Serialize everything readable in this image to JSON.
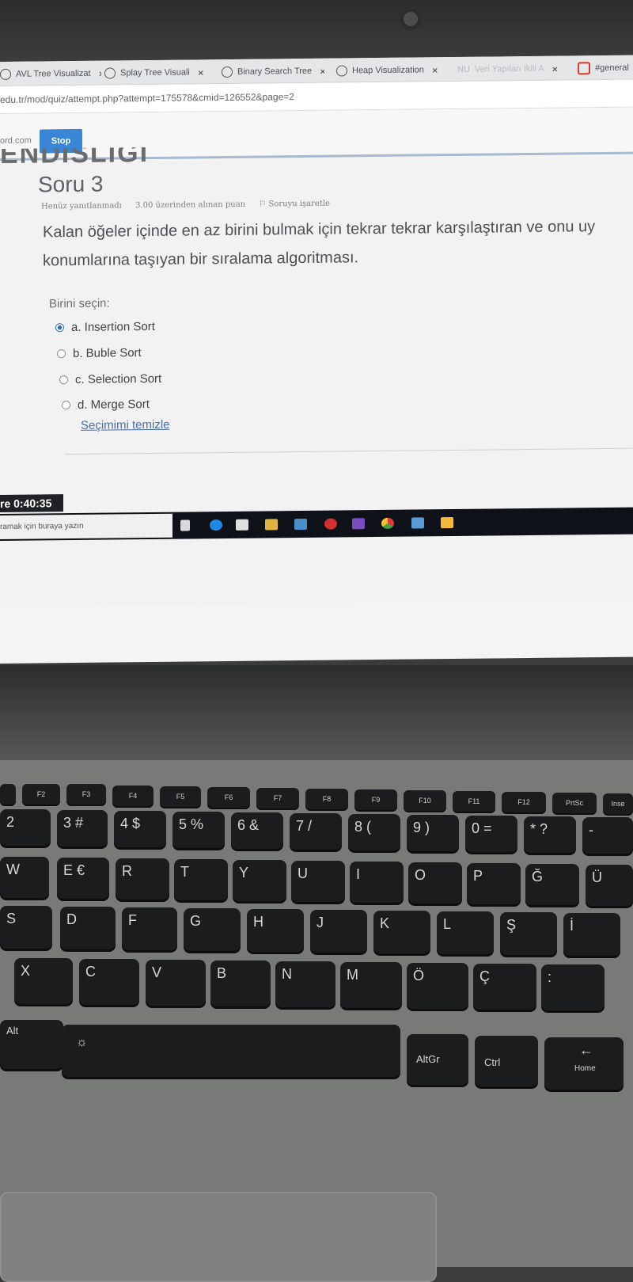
{
  "browser": {
    "tabs": [
      {
        "label": "AVL Tree Visualizat",
        "close": "×"
      },
      {
        "label": "Splay Tree Visuali",
        "close": "×"
      },
      {
        "label": "Binary Search Tree",
        "close": "×"
      },
      {
        "label": "Heap Visualization",
        "close": "×"
      },
      {
        "label": "Veri Yapıları İkili A",
        "close": "×",
        "prefix": "NU"
      },
      {
        "label": "#general",
        "close": ""
      }
    ],
    "url": "edu.tr/mod/quiz/attempt.php?attempt=175578&cmid=126552&page=2"
  },
  "bar": {
    "site": "ord.com",
    "stop_label": "Stop"
  },
  "banner": {
    "text": "ENDISLIGI"
  },
  "question": {
    "title": "Soru 3",
    "status": "Henüz yanıtlanmadı",
    "points": "3.00 üzerinden alınan puan",
    "flag": "Soruyu işaretle",
    "text": "Kalan öğeler içinde en az birini bulmak için tekrar tekrar karşılaştıran ve onu uy konumlarına taşıyan bir sıralama algoritması.",
    "choose_label": "Birini seçin:",
    "options": [
      {
        "label": "a. Insertion Sort",
        "selected": true
      },
      {
        "label": "b. Buble Sort",
        "selected": false
      },
      {
        "label": "c. Selection Sort",
        "selected": false
      },
      {
        "label": "d. Merge Sort",
        "selected": false
      }
    ],
    "clear_label": "Seçimimi temizle"
  },
  "timer": {
    "text": "re 0:40:35"
  },
  "taskbar": {
    "search_placeholder": "ramak için buraya yazın"
  },
  "keyboard": {
    "row_numbers": [
      "2",
      "3 #",
      "4 $",
      "5 %",
      "6 &",
      "7 /",
      "8 (",
      "9 )",
      "0 =",
      "* ?",
      "-"
    ],
    "row_q": [
      "W",
      "E €",
      "R",
      "T",
      "Y",
      "U",
      "I",
      "O",
      "P",
      "Ğ",
      "Ü"
    ],
    "row_a": [
      "S",
      "D",
      "F",
      "G",
      "H",
      "J",
      "K",
      "L",
      "Ş",
      "İ"
    ],
    "row_z": [
      "X",
      "C",
      "V",
      "B",
      "N",
      "M",
      "Ö",
      "Ç",
      ":"
    ],
    "row_bottom": [
      "Alt",
      "AltGr",
      "Ctrl",
      "Home"
    ],
    "fkeys": [
      "F2",
      "F3",
      "F4",
      "F5",
      "F6",
      "F7",
      "F8",
      "F9",
      "F10",
      "F11",
      "F12",
      "PrtSc",
      "Inse"
    ]
  }
}
